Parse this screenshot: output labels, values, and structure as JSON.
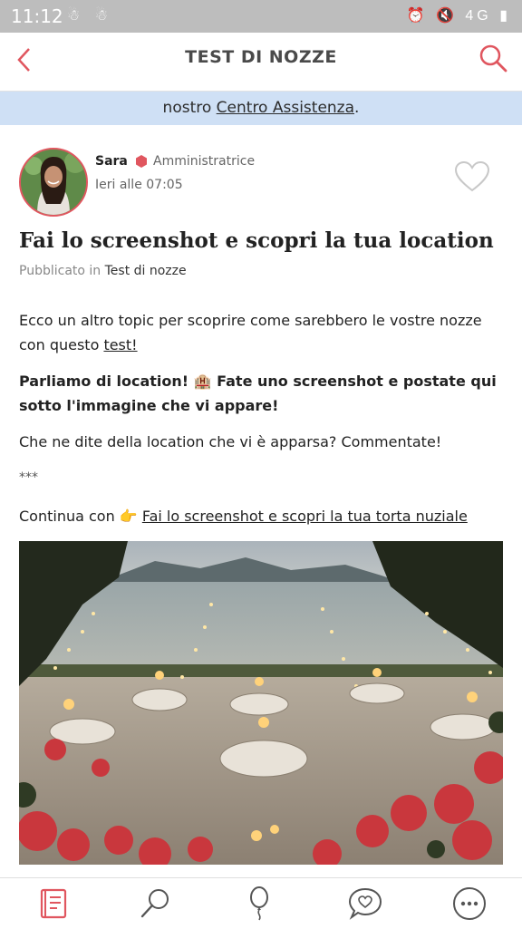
{
  "status_bar": {
    "time": "11:12",
    "left_icons": "☃ ☃",
    "right_icons": "⏰ 🔇 4G ▮"
  },
  "app_bar": {
    "title": "TEST DI NOZZE",
    "back_icon": "chevron-left-icon",
    "search_icon": "search-icon"
  },
  "banner": {
    "text_before": "nostro ",
    "link": "Centro Assistenza",
    "text_after": "."
  },
  "post": {
    "author": "Sara",
    "role": "Amministratrice",
    "time": "Ieri alle 07:05",
    "title": "Fai lo screenshot e scopri la tua location",
    "published_label": "Pubblicato in",
    "category": "Test di nozze",
    "p1_text": "Ecco un altro topic per scoprire come sarebbero le vostre nozze con questo ",
    "p1_link": "test!",
    "p2_a": "Parliamo di location! ",
    "p2_emoji": "🏨",
    "p2_b": " Fate uno screenshot e postate qui sotto l'immagine che vi appare!",
    "p3": "Che ne dite della location che vi è apparsa? Commentate!",
    "p4": "***",
    "p5_text": "Continua con ",
    "p5_emoji": "👉",
    "p5_link": "Fai lo screenshot e scopri la tua torta nuziale"
  },
  "colors": {
    "accent": "#e0565f",
    "banner_bg": "#cfe0f5",
    "status_bar": "#bdbdbd"
  },
  "bottom_nav": [
    "planner-icon",
    "search-vendors-icon",
    "balloon-icon",
    "chat-heart-icon",
    "more-icon"
  ]
}
